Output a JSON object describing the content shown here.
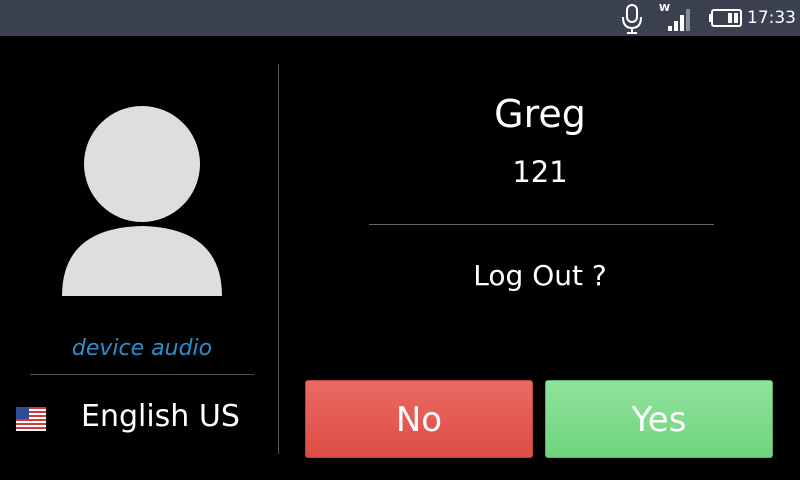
{
  "status_bar": {
    "time": "17:33",
    "network_label": "W",
    "icons": [
      "microphone-icon",
      "signal-strength-icon",
      "battery-icon"
    ]
  },
  "profile": {
    "subtitle": "device audio",
    "language": "English US",
    "avatar_icon": "person-icon",
    "flag_icon": "us-flag-icon"
  },
  "user": {
    "name": "Greg",
    "extension": "121"
  },
  "dialog": {
    "prompt": "Log Out ?",
    "no_label": "No",
    "yes_label": "Yes"
  },
  "colors": {
    "status_bar": "#3c4150",
    "background": "#000000",
    "accent_text": "#2a8fcf",
    "no_button": "#dd4d46",
    "yes_button": "#6fd47e"
  }
}
